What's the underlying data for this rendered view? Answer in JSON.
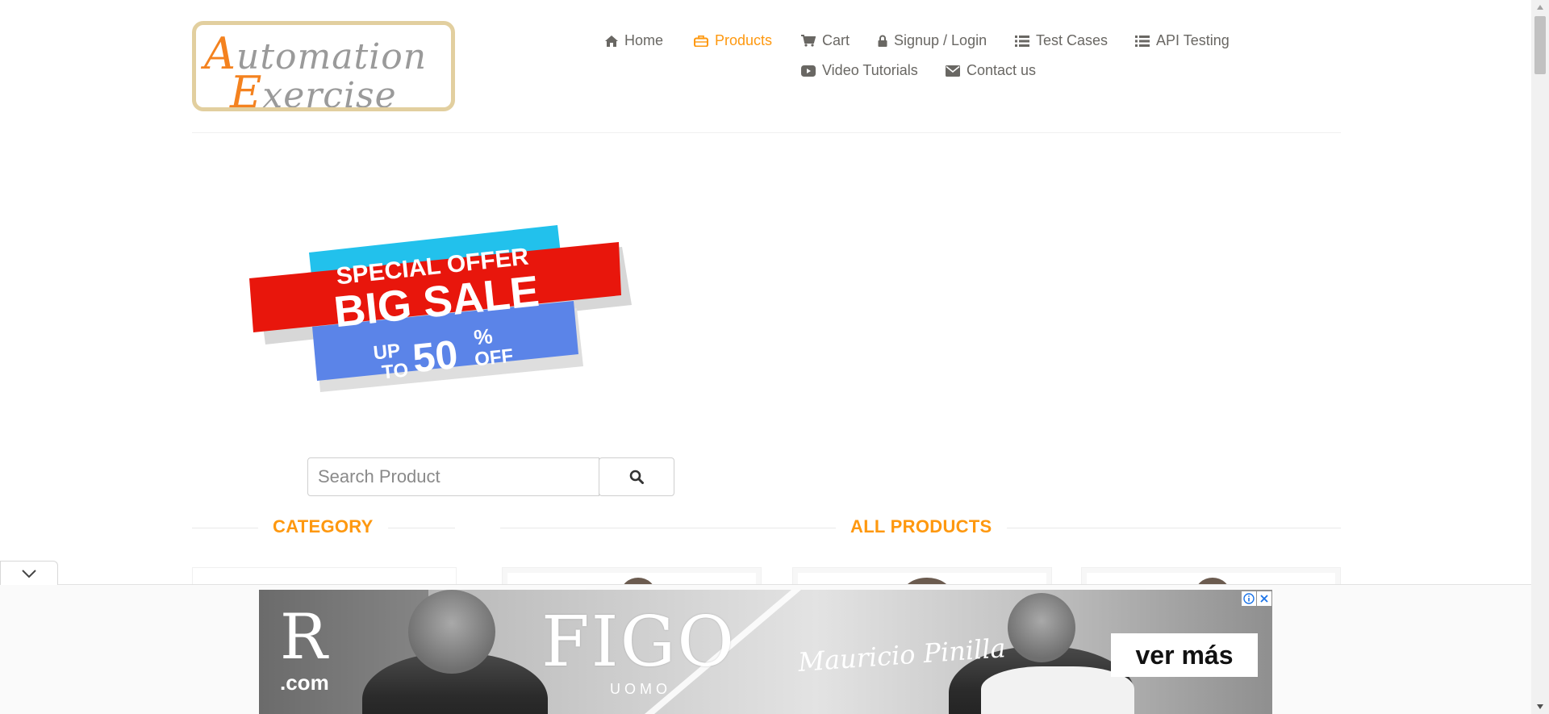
{
  "site": {
    "logo_line1_first": "A",
    "logo_line1_rest": "utomation",
    "logo_line2_first": "E",
    "logo_line2_rest": "xercise"
  },
  "nav": {
    "items": [
      {
        "label": "Home",
        "icon": "home-icon",
        "active": false
      },
      {
        "label": "Products",
        "icon": "briefcase-icon",
        "active": true
      },
      {
        "label": "Cart",
        "icon": "cart-icon",
        "active": false
      },
      {
        "label": "Signup / Login",
        "icon": "lock-icon",
        "active": false
      },
      {
        "label": "Test Cases",
        "icon": "list-icon",
        "active": false
      },
      {
        "label": "API Testing",
        "icon": "list-icon",
        "active": false
      },
      {
        "label": "Video Tutorials",
        "icon": "youtube-play-icon",
        "active": false
      },
      {
        "label": "Contact us",
        "icon": "envelope-icon",
        "active": false
      }
    ]
  },
  "banner": {
    "special_offer": "SPECIAL OFFER",
    "big_sale": "BIG SALE",
    "up": "UP",
    "to": "TO",
    "percent_value": "50",
    "percent_sign": "%",
    "off": "OFF"
  },
  "search": {
    "placeholder": "Search Product",
    "value": ""
  },
  "sections": {
    "category_title": "CATEGORY",
    "products_title": "ALL PRODUCTS"
  },
  "ad": {
    "logo_r": "R",
    "logo_com": ".com",
    "brand": "FIGO",
    "brand_sub": "UOMO",
    "signature": "Mauricio Pinilla",
    "cta": "ver más"
  },
  "colors": {
    "accent": "#FE980F",
    "text": "#696763",
    "logo_orange": "#F4821F",
    "logo_border": "#E2CF9F",
    "banner_cyan": "#22C1EC",
    "banner_red": "#E8160C",
    "banner_blue": "#5B84E8"
  }
}
